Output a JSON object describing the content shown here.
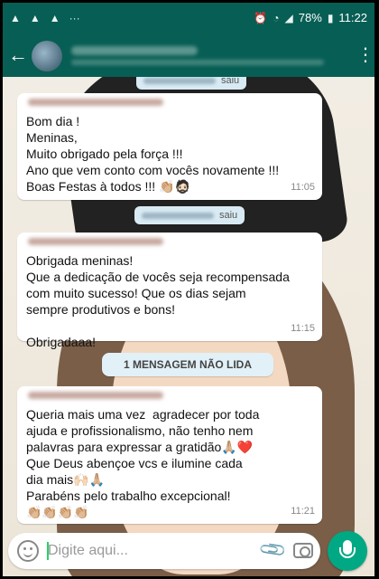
{
  "status_bar": {
    "battery": "78%",
    "time": "11:22",
    "left_icons": [
      "image-icon",
      "image-icon",
      "image-icon",
      "more-notifications-icon"
    ],
    "right_icons": [
      "alarm-icon",
      "wifi-icon",
      "signal-icon",
      "battery-icon"
    ]
  },
  "header": {
    "back_icon": "arrow-left-icon",
    "menu_icon": "more-vert-icon"
  },
  "chat": {
    "system_messages": [
      {
        "suffix": "saiu"
      },
      {
        "suffix": "saiu"
      }
    ],
    "messages": [
      {
        "lines": [
          "Bom dia !",
          "Meninas,",
          "Muito obrigado pela força !!!",
          "Ano que vem conto com vocês novamente !!!",
          "Boas Festas à todos !!! 👏🏼🧔🏻"
        ],
        "time": "11:05"
      },
      {
        "lines": [
          "Obrigada meninas!",
          "Que a dedicação de vocês seja recompensada",
          "com muito sucesso! Que os dias sejam",
          "sempre produtivos e bons!",
          "",
          "Obrigadaaa!"
        ],
        "time": "11:15"
      },
      {
        "lines": [
          "Queria mais uma vez  agradecer por toda",
          "ajuda e profissionalismo, não tenho nem",
          "palavras para expressar a gratidão🙏🏼❤️",
          "Que Deus abençoe vcs e ilumine cada",
          "dia mais🙌🏻🙏🏼",
          "Parabéns pelo trabalho excepcional!",
          "👏🏼👏🏼👏🏼👏🏼"
        ],
        "time": "11:21"
      }
    ],
    "unread_banner": "1 MENSAGEM NÃO LIDA"
  },
  "composer": {
    "placeholder": "Digite aqui...",
    "icons": [
      "emoji-icon",
      "attach-icon",
      "camera-icon",
      "mic-icon"
    ]
  },
  "colors": {
    "header": "#075e54",
    "accent": "#00a884",
    "bubble": "#ffffff",
    "system_pill": "#d8eaf3"
  }
}
